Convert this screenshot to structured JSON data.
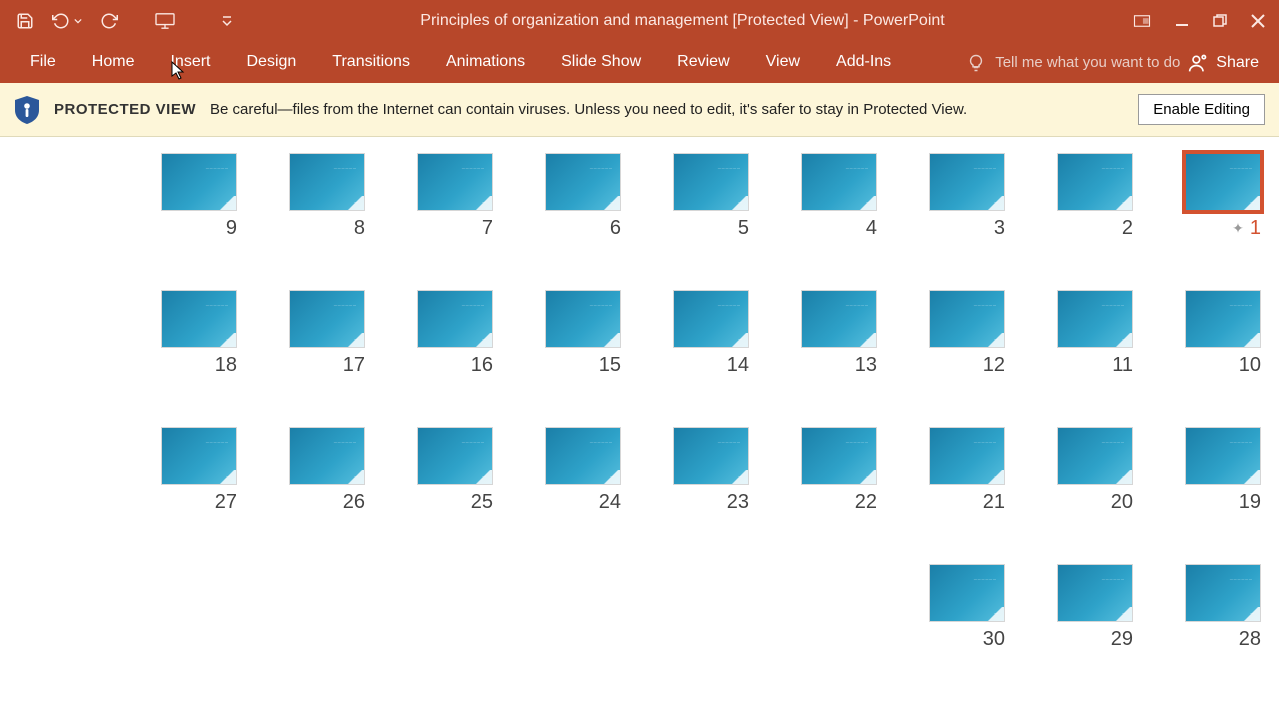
{
  "app": {
    "title": "Principles of organization and management [Protected View] - PowerPoint"
  },
  "ribbon": {
    "tabs": [
      "File",
      "Home",
      "Insert",
      "Design",
      "Transitions",
      "Animations",
      "Slide Show",
      "Review",
      "View",
      "Add-Ins"
    ],
    "tellme": "Tell me what you want to do",
    "share": "Share"
  },
  "protected_view": {
    "label": "PROTECTED VIEW",
    "message": "Be careful—files from the Internet can contain viruses. Unless you need to edit, it's safer to stay in Protected View.",
    "button": "Enable Editing"
  },
  "slides": {
    "selected": 1,
    "rows": [
      [
        1,
        2,
        3,
        4,
        5,
        6,
        7,
        8,
        9
      ],
      [
        10,
        11,
        12,
        13,
        14,
        15,
        16,
        17,
        18
      ],
      [
        19,
        20,
        21,
        22,
        23,
        24,
        25,
        26,
        27
      ],
      [
        28,
        29,
        30
      ]
    ],
    "has_transition": [
      1
    ]
  }
}
